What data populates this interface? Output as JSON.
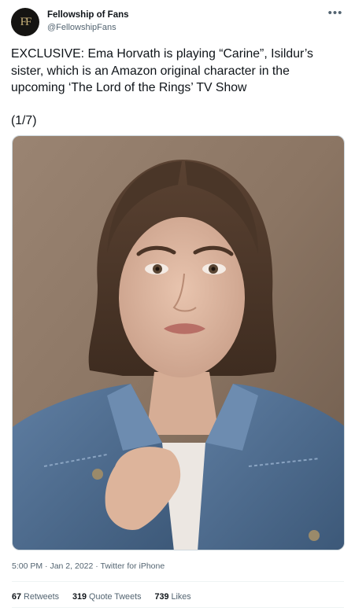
{
  "author": {
    "display_name": "Fellowship of Fans",
    "handle": "@FellowshipFans",
    "avatar_monogram": "FF",
    "avatar_icon": "fellowship-logo"
  },
  "more_menu_icon": "ellipsis-icon",
  "tweet": {
    "text": "EXCLUSIVE: Ema Horvath is playing “Carine”, Isildur’s sister, which is an Amazon original character in the upcoming ‘The Lord of the Rings’ TV Show",
    "thread_count": "(1/7)"
  },
  "media": {
    "kind": "portrait-photo"
  },
  "meta": {
    "time": "5:00 PM",
    "sep1": " · ",
    "date": "Jan 2, 2022",
    "sep2": " · ",
    "source": "Twitter for iPhone"
  },
  "stats": {
    "retweets_count": "67",
    "retweets_label": "Retweets",
    "quotes_count": "319",
    "quotes_label": "Quote Tweets",
    "likes_count": "739",
    "likes_label": "Likes"
  },
  "colors": {
    "text": "#0f1419",
    "secondary": "#536471",
    "divider": "#eff3f4",
    "photo_background": "#8a7462",
    "denim": "#4d6b8e"
  }
}
